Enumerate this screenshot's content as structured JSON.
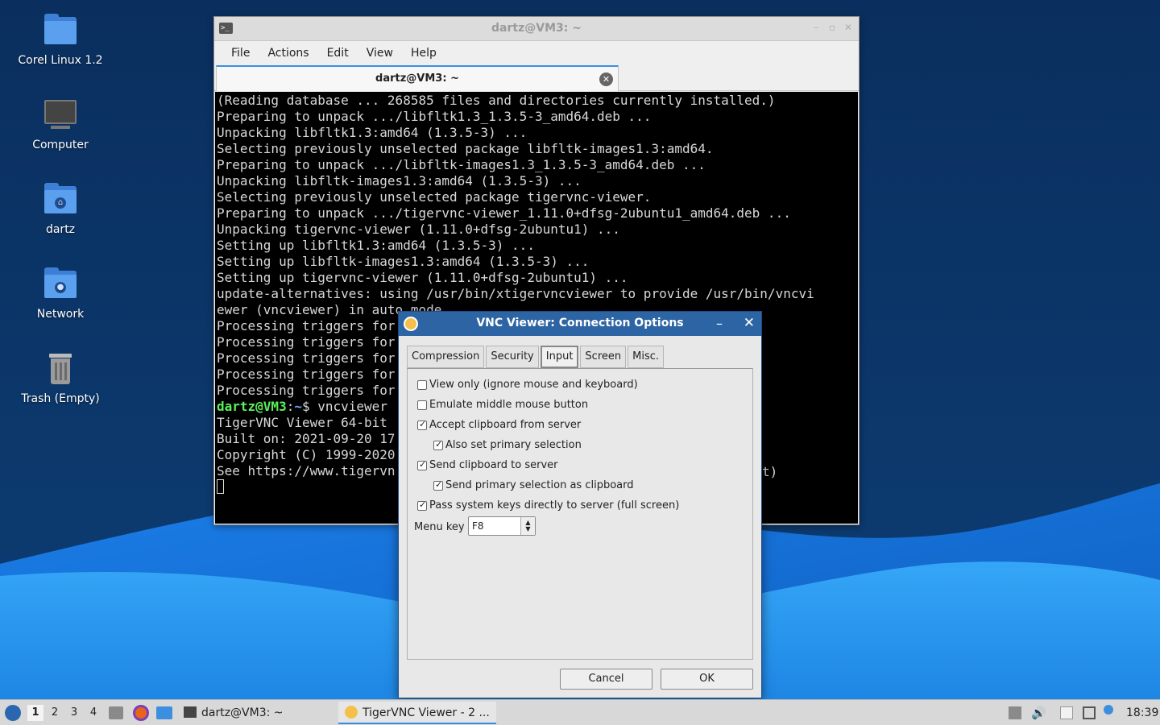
{
  "desktop": {
    "icons": [
      {
        "label": "Corel Linux 1.2",
        "icon": "folder-icon"
      },
      {
        "label": "Computer",
        "icon": "computer-icon"
      },
      {
        "label": "dartz",
        "icon": "home-folder-icon"
      },
      {
        "label": "Network",
        "icon": "network-folder-icon"
      },
      {
        "label": "Trash (Empty)",
        "icon": "trash-icon"
      }
    ]
  },
  "terminal": {
    "title": "dartz@VM3: ~",
    "menu": [
      "File",
      "Actions",
      "Edit",
      "View",
      "Help"
    ],
    "tab_label": "dartz@VM3: ~",
    "lines": [
      "(Reading database ... 268585 files and directories currently installed.)",
      "Preparing to unpack .../libfltk1.3_1.3.5-3_amd64.deb ...",
      "Unpacking libfltk1.3:amd64 (1.3.5-3) ...",
      "Selecting previously unselected package libfltk-images1.3:amd64.",
      "Preparing to unpack .../libfltk-images1.3_1.3.5-3_amd64.deb ...",
      "Unpacking libfltk-images1.3:amd64 (1.3.5-3) ...",
      "Selecting previously unselected package tigervnc-viewer.",
      "Preparing to unpack .../tigervnc-viewer_1.11.0+dfsg-2ubuntu1_amd64.deb ...",
      "Unpacking tigervnc-viewer (1.11.0+dfsg-2ubuntu1) ...",
      "Setting up libfltk1.3:amd64 (1.3.5-3) ...",
      "Setting up libfltk-images1.3:amd64 (1.3.5-3) ...",
      "Setting up tigervnc-viewer (1.11.0+dfsg-2ubuntu1) ...",
      "update-alternatives: using /usr/bin/xtigervncviewer to provide /usr/bin/vncvi",
      "ewer (vncviewer) in auto mode",
      "Processing triggers for",
      "Processing triggers for",
      "Processing triggers for",
      "Processing triggers for",
      "Processing triggers for"
    ],
    "prompt_user": "dartz@VM3",
    "prompt_sep": ":",
    "prompt_path": "~",
    "prompt_symbol": "$ ",
    "command": "vncviewer",
    "output_lines": [
      "",
      "TigerVNC Viewer 64-bit",
      "Built on: 2021-09-20 17",
      "Copyright (C) 1999-2020",
      "See https://www.tigervn"
    ],
    "hidden_fragment": "t)"
  },
  "vnc_dialog": {
    "title": "VNC Viewer: Connection Options",
    "tabs": [
      "Compression",
      "Security",
      "Input",
      "Screen",
      "Misc."
    ],
    "active_tab": "Input",
    "options": [
      {
        "label": "View only (ignore mouse and keyboard)",
        "checked": false
      },
      {
        "label": "Emulate middle mouse button",
        "checked": false
      },
      {
        "label": "Accept clipboard from server",
        "checked": true
      },
      {
        "label": "Also set primary selection",
        "checked": true
      },
      {
        "label": "Send clipboard to server",
        "checked": true
      },
      {
        "label": "Send primary selection as clipboard",
        "checked": true
      },
      {
        "label": "Pass system keys directly to server (full screen)",
        "checked": true
      }
    ],
    "menu_key_label": "Menu key",
    "menu_key_value": "F8",
    "cancel_label": "Cancel",
    "ok_label": "OK"
  },
  "taskbar": {
    "workspaces": [
      "1",
      "2",
      "3",
      "4"
    ],
    "active_workspace": "1",
    "tasks": [
      {
        "label": "dartz@VM3: ~",
        "icon": "terminal-icon"
      },
      {
        "label": "TigerVNC Viewer - 2 ...",
        "icon": "tigervnc-icon"
      }
    ],
    "clock": "18:39"
  },
  "colors": {
    "accent": "#3c8ee0",
    "dialog_title": "#2d64a3",
    "prompt_user": "#5bf05b",
    "prompt_path": "#6aa8ff"
  }
}
